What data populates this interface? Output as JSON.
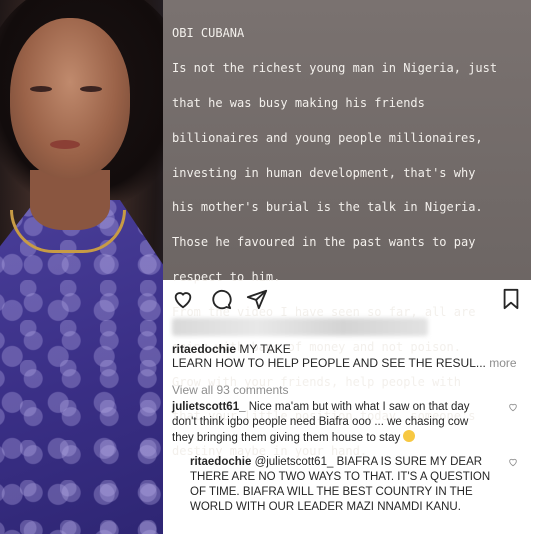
{
  "story": {
    "lines": [
      "OBI CUBANA",
      "Is not the richest young man in Nigeria, just",
      "that he was busy making his friends",
      "billionaires and young people millionaires,",
      "investing in human development, that's why",
      "his mother's burial is the talk in Nigeria.",
      "Those he favoured in the past wants to pay",
      "respect to him.",
      "From the video I have seen so far, all are",
      "going with bags of money and not poison.",
      "Grow with your friends, help people with",
      "that your little position today, someone's",
      "destiny maybe in your hand."
    ]
  },
  "actions": {
    "like_icon": "heart-icon",
    "comment_icon": "comment-icon",
    "share_icon": "send-icon",
    "save_icon": "bookmark-icon"
  },
  "caption": {
    "username": "ritaedochie",
    "line1": "MY TAKE",
    "line2": "LEARN HOW TO HELP PEOPLE AND SEE THE RESUL...",
    "more": "more"
  },
  "view_all": "View all 93 comments",
  "comments": [
    {
      "username": "julietscott61_",
      "line1": "Nice ma'am but with what I saw on that day",
      "line2": "don't think igbo people need Biafra ooo ... we chasing cow",
      "line3": "they bringing them giving them house to stay"
    },
    {
      "username": "ritaedochie",
      "mention": "@julietscott61_",
      "line1": "BIAFRA IS SURE MY DEAR",
      "line2": "THERE ARE NO TWO WAYS TO THAT. IT'S A QUESTION",
      "line3": "OF TIME. BIAFRA WILL THE BEST COUNTRY IN THE",
      "line4": "WORLD WITH OUR LEADER MAZI NNAMDI KANU."
    }
  ]
}
